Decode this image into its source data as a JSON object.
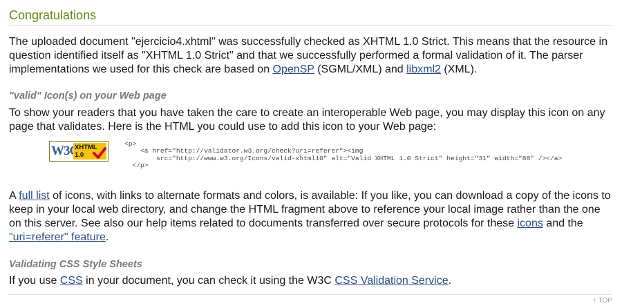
{
  "congratulations": {
    "title": "Congratulations",
    "para1": {
      "text_a": "The uploaded document \"ejercicio4.xhtml\" was successfully checked as XHTML 1.0 Strict. This means that the resource in question identified itself as \"XHTML 1.0 Strict\" and that we successfully performed a formal validation of it. The parser implementations we used for this check are based on ",
      "link_opensp": "OpenSP",
      "text_b": " (SGML/XML) and ",
      "link_libxml2": "libxml2",
      "text_c": " (XML)."
    }
  },
  "valid_icon": {
    "heading": "\"valid\" Icon(s) on your Web page",
    "para": "To show your readers that you have taken the care to create an interoperable Web page, you may display this icon on any page that validates. Here is the HTML you could use to add this icon to your Web page:",
    "badge": {
      "w3c": "W3C",
      "line1": "XHTML",
      "line2": "1.0",
      "check_color": "#c8102e",
      "panel_color": "#f4c20e"
    },
    "code_snippet": "<p>\n    <a href=\"http://validator.w3.org/check?uri=referer\"><img\n        src=\"http://www.w3.org/Icons/valid-xhtml10\" alt=\"Valid XHTML 1.0 Strict\" height=\"31\" width=\"88\" /></a>\n  </p>"
  },
  "icons_para": {
    "text_a": "A ",
    "link_full_list": "full list",
    "text_b": " of icons, with links to alternate formats and colors, is available: If you like, you can download a copy of the icons to keep in your local web directory, and change the HTML fragment above to reference your local image rather than the one on this server. See also our help items related to documents transferred over secure protocols for these ",
    "link_icons": "icons",
    "text_c": " and the ",
    "link_uri_referer": "\"uri=referer\" feature",
    "text_d": "."
  },
  "css_section": {
    "heading": "Validating CSS Style Sheets",
    "text_a": "If you use ",
    "link_css": "CSS",
    "text_b": " in your document, you can check it using the W3C ",
    "link_css_service": "CSS Validation Service",
    "text_c": "."
  },
  "top_link": "↑ TOP",
  "colors": {
    "title_green": "#5e8c10",
    "link_blue": "#2a4d86",
    "subheading_gray": "#7a7a7a"
  }
}
